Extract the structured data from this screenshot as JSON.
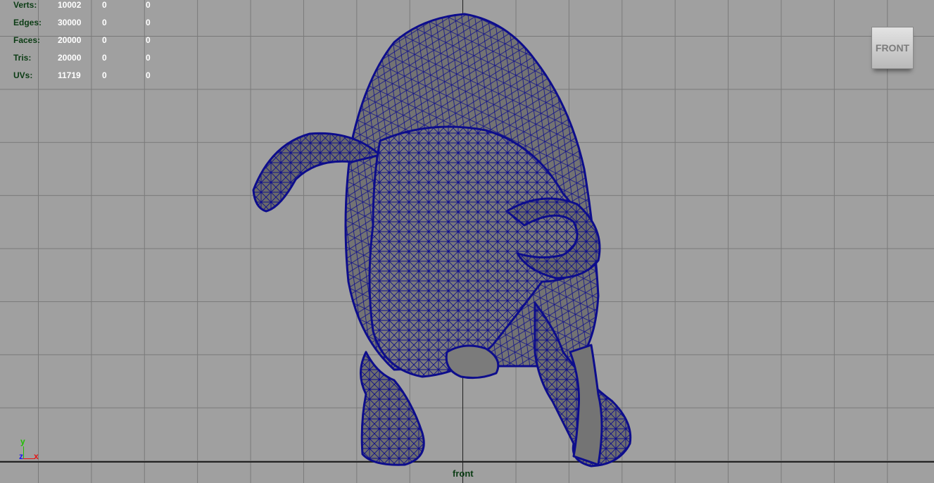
{
  "hud": {
    "rows": [
      {
        "label": "Verts:",
        "v1": "10002",
        "v2": "0",
        "v3": "0"
      },
      {
        "label": "Edges:",
        "v1": "30000",
        "v2": "0",
        "v3": "0"
      },
      {
        "label": "Faces:",
        "v1": "20000",
        "v2": "0",
        "v3": "0"
      },
      {
        "label": "Tris:",
        "v1": "20000",
        "v2": "0",
        "v3": "0"
      },
      {
        "label": "UVs:",
        "v1": "11719",
        "v2": "0",
        "v3": "0"
      }
    ]
  },
  "viewcube": {
    "label": "FRONT"
  },
  "camera": {
    "label": "front"
  },
  "gnomon": {
    "y": "y",
    "z": "z",
    "x": "x"
  },
  "colors": {
    "background": "#a0a0a0",
    "grid": "#7a7a7a",
    "wireframe": "#0d0d8c",
    "mesh_fill": "#737373",
    "hud_label": "#0b3c14",
    "hud_value": "#ffffff"
  }
}
